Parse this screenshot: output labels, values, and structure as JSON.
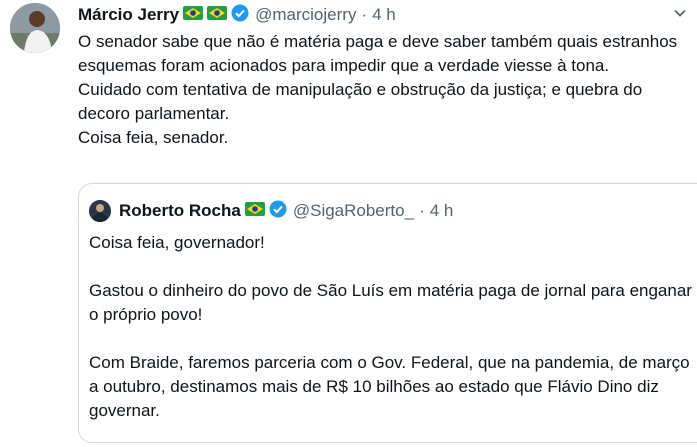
{
  "tweet": {
    "author_name": "Márcio Jerry",
    "handle": "@marciojerry",
    "separator": "·",
    "time": "4 h",
    "flags": [
      "brazil-flag",
      "brazil-flag"
    ],
    "paragraphs": [
      "O senador sabe que não é matéria paga e deve saber também quais estranhos esquemas foram acionados para impedir que a verdade viesse à tona.",
      "Cuidado com tentativa de manipulação e obstrução da justiça; e quebra do decoro parlamentar.",
      "Coisa feia, senador."
    ]
  },
  "quoted_tweet": {
    "author_name": "Roberto Rocha",
    "handle": "@SigaRoberto_",
    "separator": "·",
    "time": "4 h",
    "paragraphs": [
      "Coisa feia, governador!",
      "Gastou o dinheiro do povo de São Luís em matéria paga de jornal para enganar o próprio povo!",
      "Com Braide, faremos parceria com o Gov. Federal, que na pandemia, de março a outubro, destinamos mais de R$ 10 bilhões ao estado que Flávio Dino diz governar."
    ]
  },
  "colors": {
    "verified_blue": "#1d9bf0",
    "secondary_text": "#536471",
    "border": "#cfd9de"
  }
}
